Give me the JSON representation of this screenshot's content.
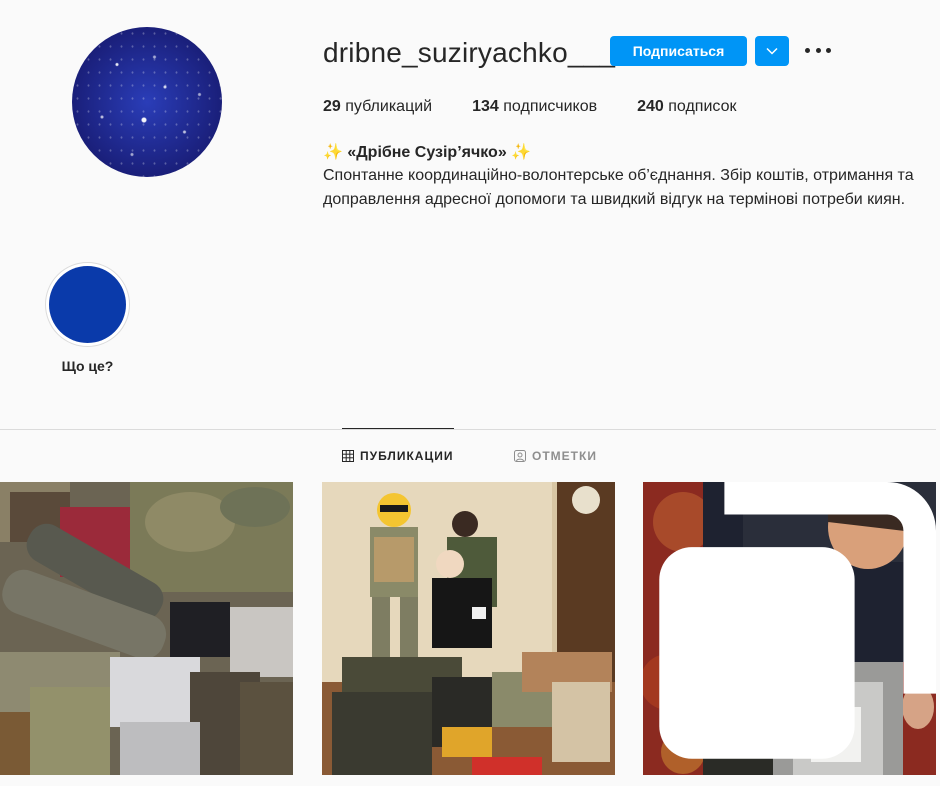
{
  "profile": {
    "username": "dribne_suziryachko___",
    "follow_label": "Подписаться",
    "stats": [
      {
        "count": "29",
        "label": "публикаций"
      },
      {
        "count": "134",
        "label": "подписчиков"
      },
      {
        "count": "240",
        "label": "подписок"
      }
    ],
    "bio_title": "✨ «Дрібне Сузір’ячко» ✨",
    "bio_text": "Спонтанне координаційно-волонтерське об’єднання. Збір коштів, отримання та доправлення адресної допомоги та швидкий відгук на термінові потреби киян."
  },
  "highlights": [
    {
      "label": "Що це?",
      "color": "#0a3aaa"
    }
  ],
  "tabs": [
    {
      "label": "ПУБЛИКАЦИИ",
      "icon": "grid-icon",
      "active": true
    },
    {
      "label": "ОТМЕТКИ",
      "icon": "tagged-icon",
      "active": false
    }
  ],
  "colors": {
    "accent": "#0095f6",
    "text": "#262626",
    "muted": "#8e8e8e",
    "border": "#dbdbdb",
    "background": "#fafafa"
  },
  "posts": [
    {
      "icon": "photo",
      "multi": false
    },
    {
      "icon": "photo",
      "multi": false
    },
    {
      "icon": "photo",
      "multi": true
    }
  ]
}
